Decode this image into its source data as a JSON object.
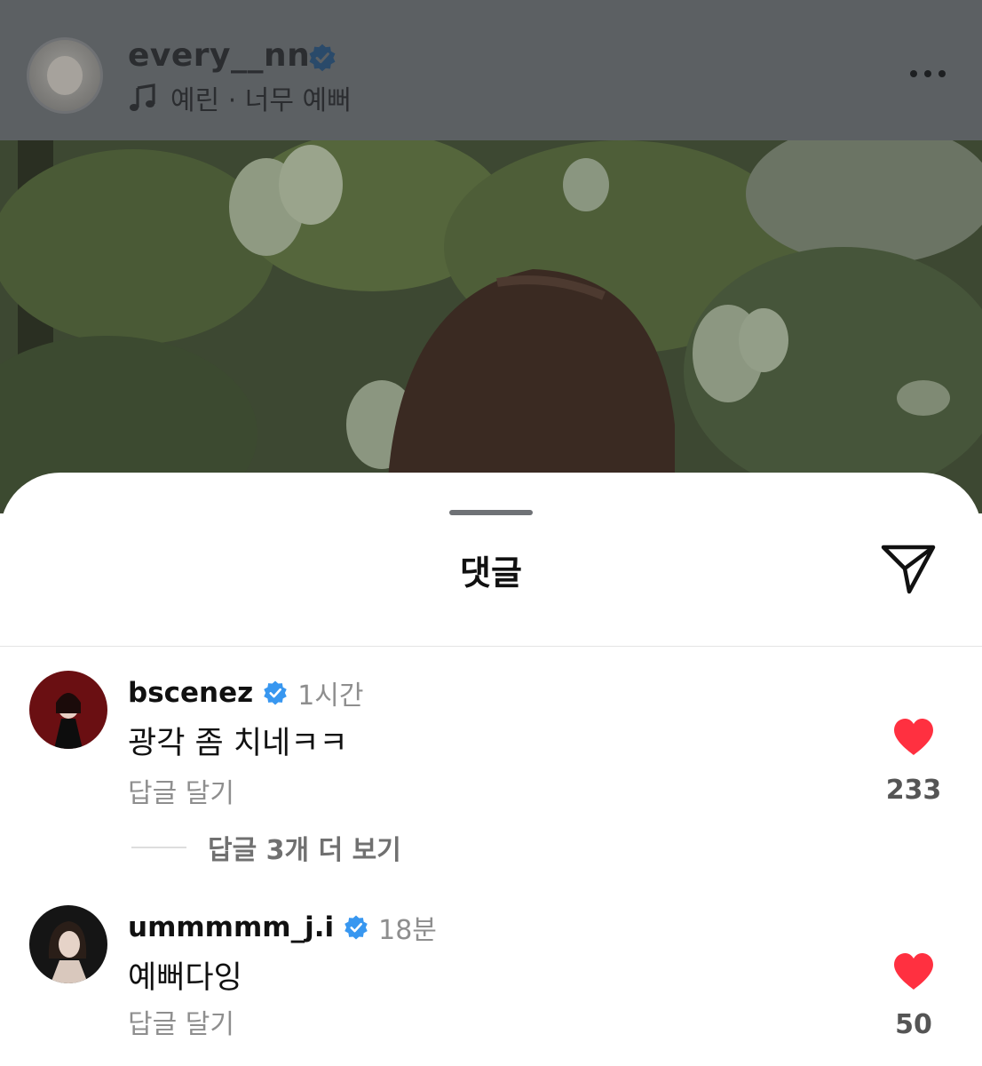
{
  "post": {
    "username": "every__nn",
    "music": "예린 · 너무 예뻐"
  },
  "sheet": {
    "title": "댓글"
  },
  "comments": [
    {
      "username": "bscenez",
      "time": "1시간",
      "text": "광각 좀 치네ㅋㅋ",
      "reply_label": "답글 달기",
      "likes": "233",
      "more_replies": "답글 3개 더 보기"
    },
    {
      "username": "ummmmm_j.i",
      "time": "18분",
      "text": "예뻐다잉",
      "reply_label": "답글 달기",
      "likes": "50"
    }
  ],
  "colors": {
    "verified": "#3897f0",
    "heart": "#ff3040",
    "overlay": "#5c6063"
  },
  "icons": [
    "verified-badge-icon",
    "music-note-icon",
    "more-options-icon",
    "send-icon",
    "heart-icon"
  ]
}
